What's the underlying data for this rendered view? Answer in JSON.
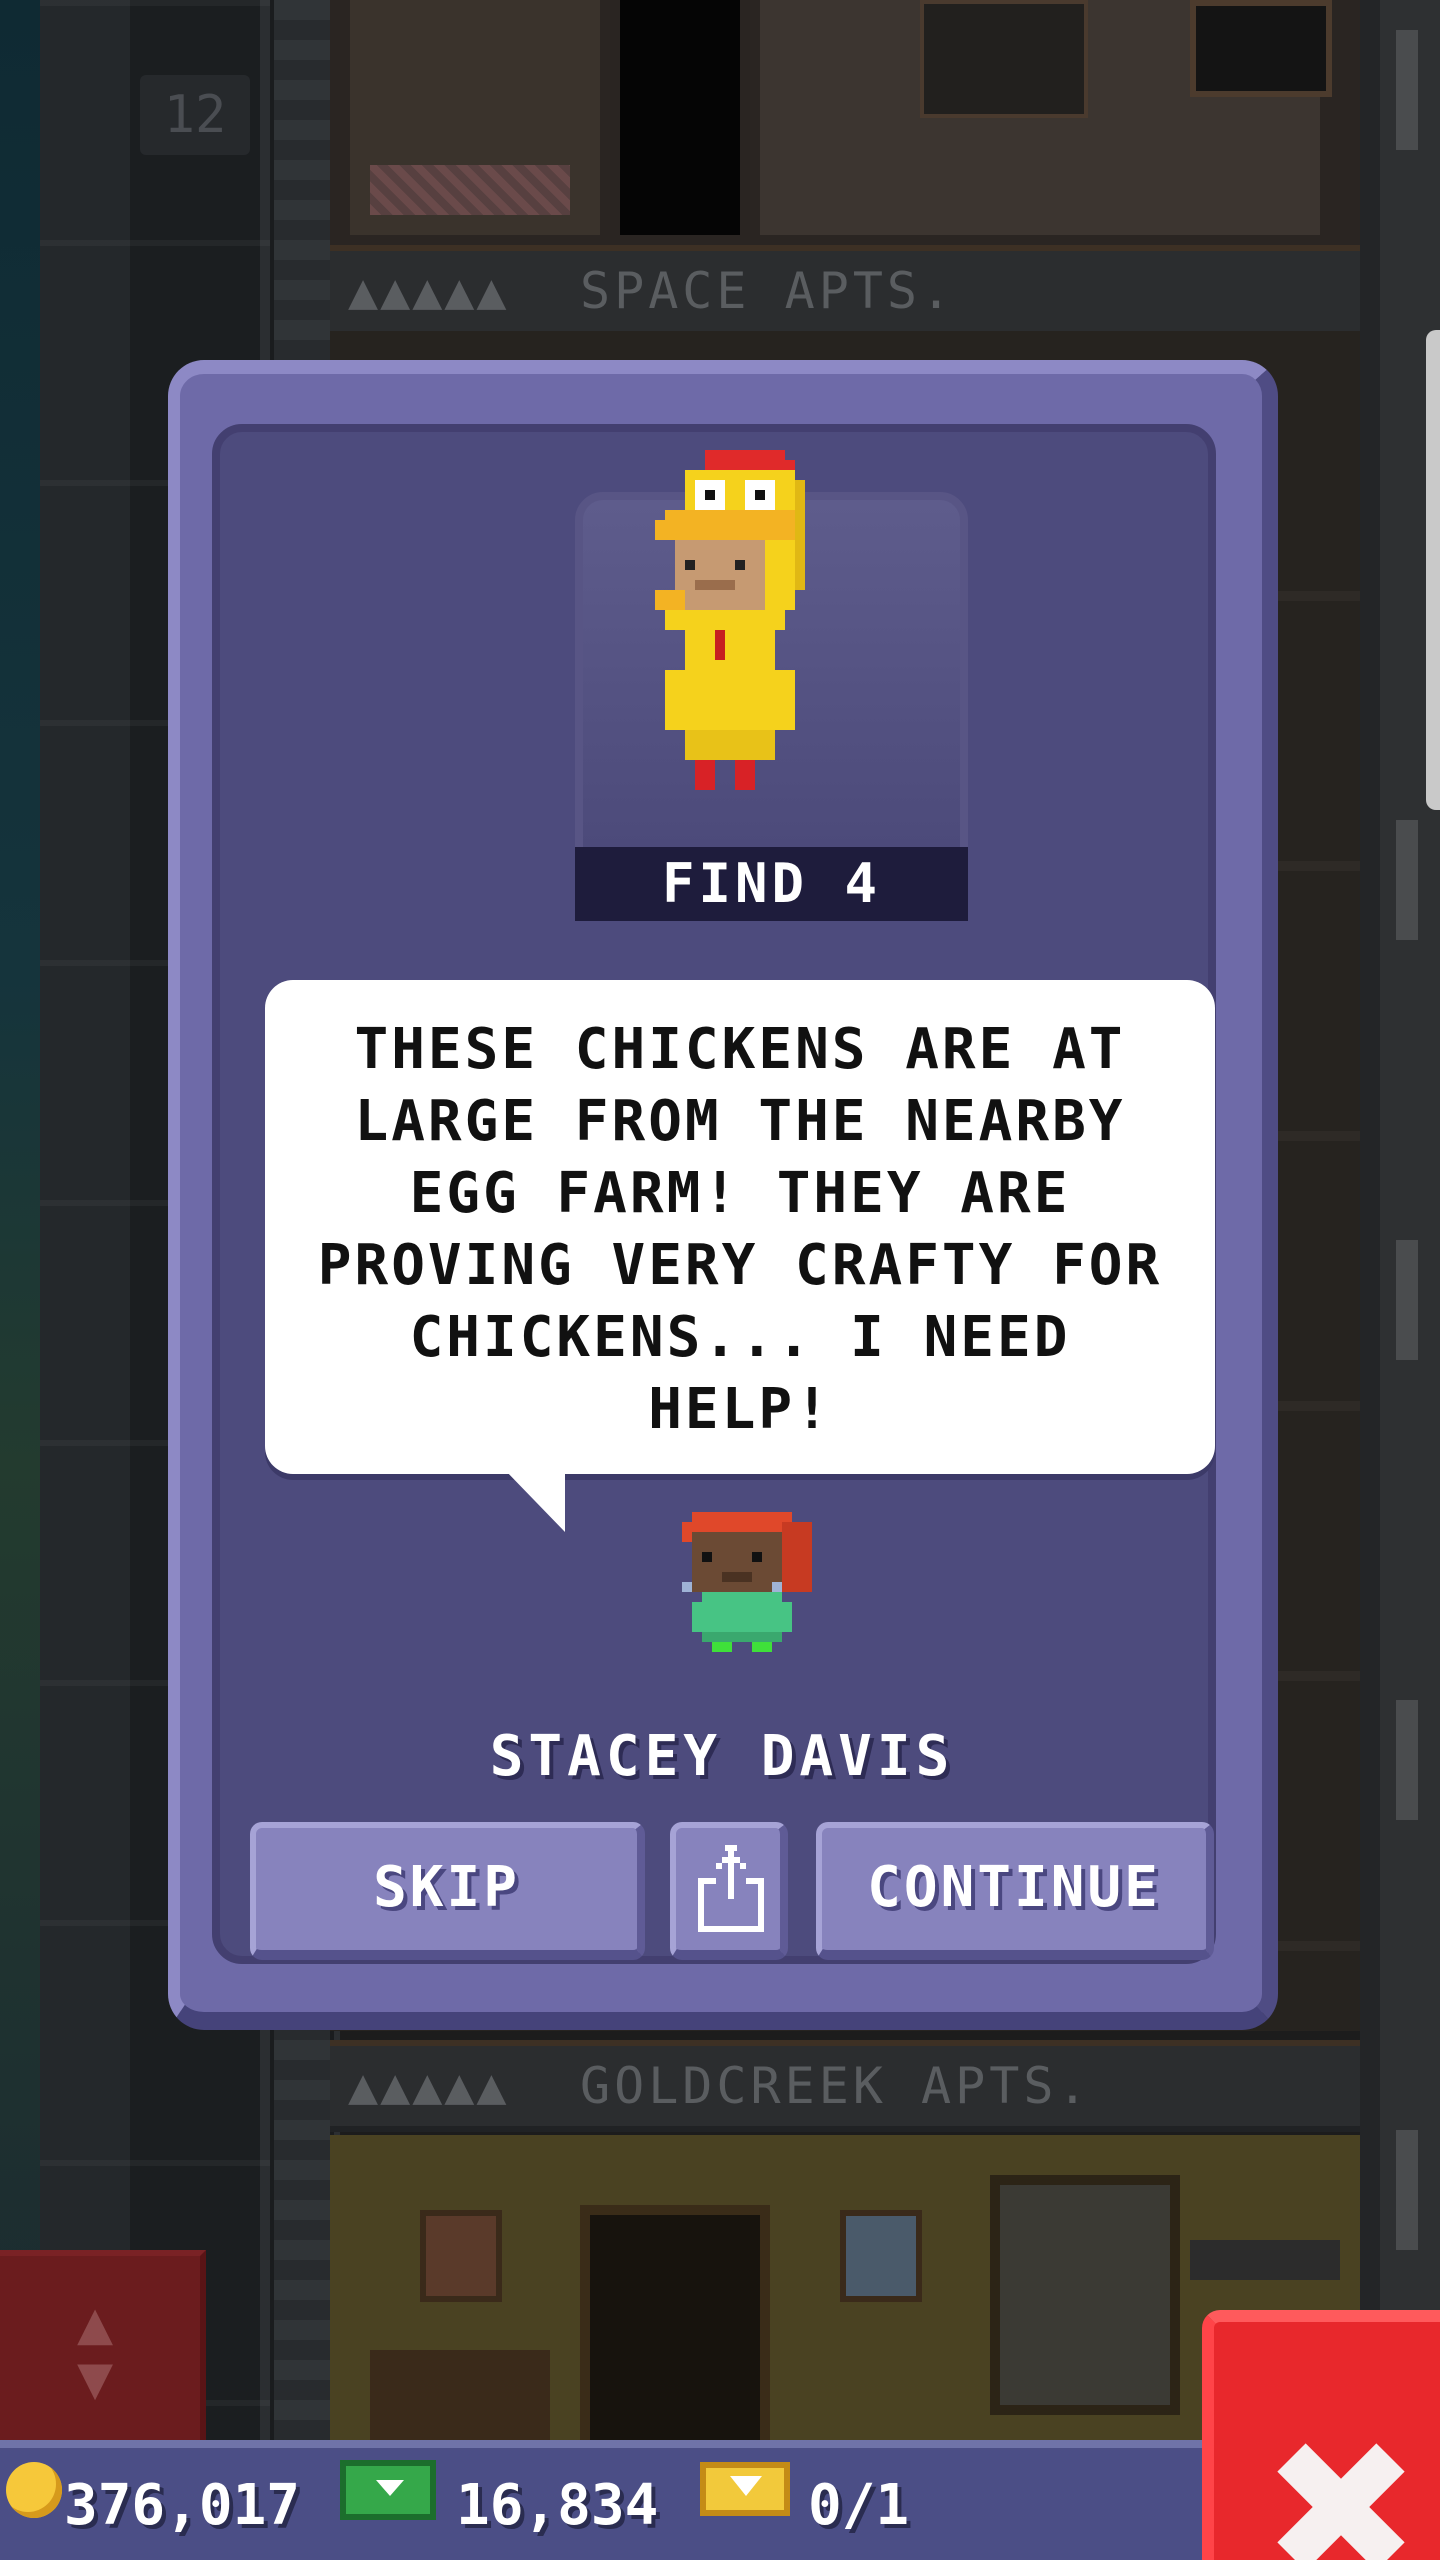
{
  "tower": {
    "floor_number": "12",
    "top_floor_sign": "SPACE APTS.",
    "bottom_floor_sign": "GOLDCREEK APTS.",
    "floor_sign_dots": "▲▲▲▲▲"
  },
  "dialog": {
    "mission_label": "FIND 4",
    "message": "THESE CHICKENS ARE AT LARGE FROM THE NEARBY EGG FARM! THEY ARE PROVING VERY CRAFTY FOR CHICKENS... I NEED HELP!",
    "speaker_name": "STACEY DAVIS",
    "skip_label": "SKIP",
    "continue_label": "CONTINUE",
    "share_icon": "share-icon",
    "mission_icon": "chicken-costume-icon"
  },
  "status": {
    "coins": "376,017",
    "bux": "16,834",
    "tickets": "0/1"
  },
  "colors": {
    "dialog_frame": "#6e6aa8",
    "dialog_inner": "#4d4b7d",
    "button": "#8783bd",
    "close_button": "#e8282c",
    "status_bar": "#4b4e86"
  }
}
